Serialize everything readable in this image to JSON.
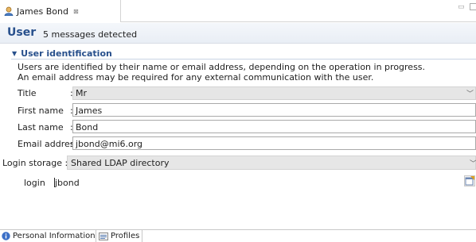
{
  "tab": {
    "label": "James Bond",
    "close_glyph": "⊠"
  },
  "header": {
    "title": "User",
    "messages": "5 messages detected"
  },
  "section": {
    "title": "User identification",
    "description_lines": [
      "Users are identified by their name or email address, depending on the operation in progress.",
      "An email address may be required for any external communication with the user."
    ]
  },
  "form": {
    "title": {
      "label": "Title",
      "value": "Mr"
    },
    "first_name": {
      "label": "First name",
      "value": "James"
    },
    "last_name": {
      "label": "Last name",
      "value": "Bond"
    },
    "email": {
      "label": "Email address",
      "value": "jbond@mi6.org"
    },
    "colon": ":"
  },
  "login": {
    "storage_label": "Login storage :",
    "storage_value": "Shared LDAP directory",
    "login_label": "login",
    "login_value": "jbond"
  },
  "bottom_tabs": [
    {
      "label": "Personal Information",
      "icon": "info-icon"
    },
    {
      "label": "Profiles",
      "icon": "profiles-icon"
    }
  ],
  "colors": {
    "accent": "#28508c",
    "info": "#3b6fc7"
  }
}
